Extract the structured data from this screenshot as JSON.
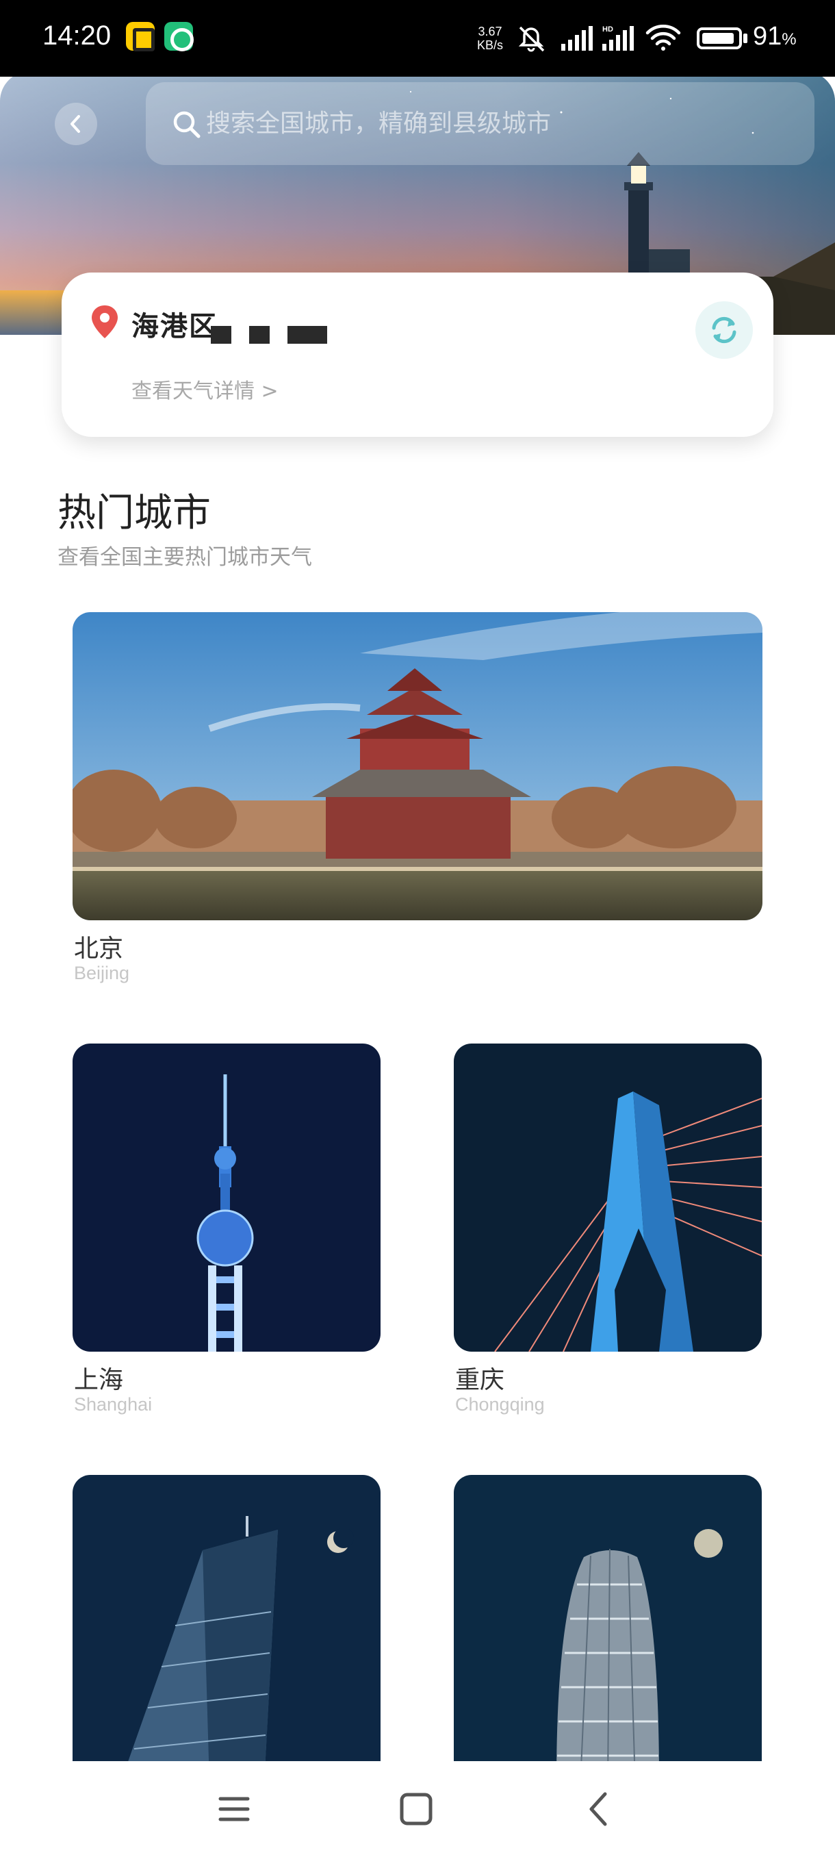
{
  "status_bar": {
    "time": "14:20",
    "net_speed_value": "3.67",
    "net_speed_unit": "KB/s",
    "battery_percent": "91",
    "battery_symbol": "%",
    "battery_level": 0.91,
    "hd_label": "HD"
  },
  "header": {
    "back_icon": "chevron-left-icon",
    "search_icon": "search-icon",
    "search_placeholder": "搜索全国城市，精确到县级城市"
  },
  "location_card": {
    "district": "海港区",
    "detail_link": "查看天气详情 >",
    "pin_color": "#e8534f",
    "refresh_color": "#5cc3c8"
  },
  "hot_cities": {
    "title": "热门城市",
    "subtitle": "查看全国主要热门城市天气",
    "cities": [
      {
        "name": "北京",
        "pinyin": "Beijing"
      },
      {
        "name": "上海",
        "pinyin": "Shanghai"
      },
      {
        "name": "重庆",
        "pinyin": "Chongqing"
      },
      {
        "name": "",
        "pinyin": ""
      },
      {
        "name": "",
        "pinyin": ""
      }
    ]
  },
  "nav_bar": {
    "menu_icon": "menu-icon",
    "home_icon": "home-square-icon",
    "back_icon": "back-triangle-icon"
  }
}
